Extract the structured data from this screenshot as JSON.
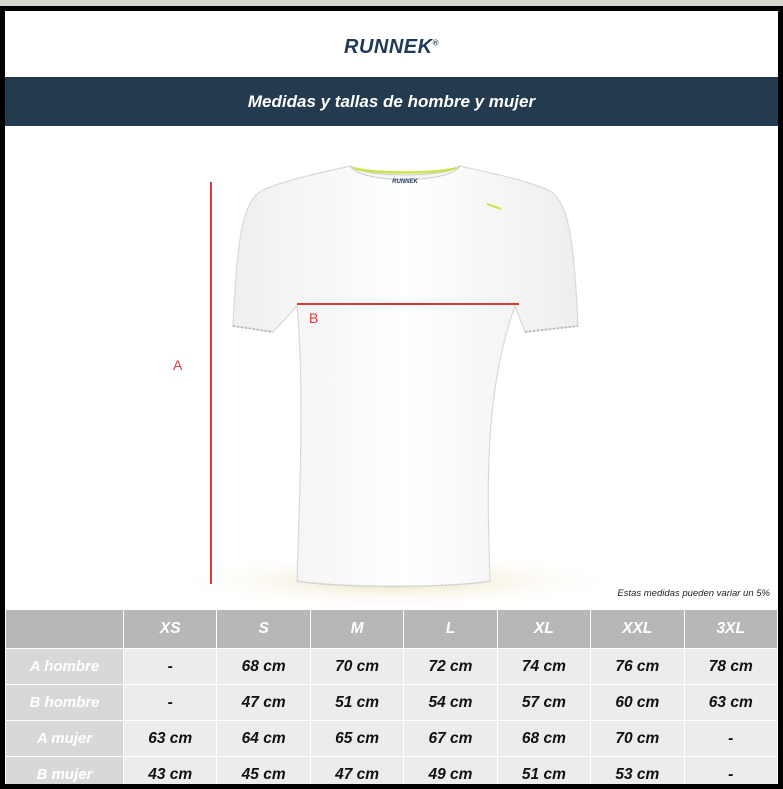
{
  "brand": {
    "name": "RUNNEK",
    "mark": "®"
  },
  "banner": {
    "title": "Medidas y tallas de hombre y mujer"
  },
  "illustration": {
    "label_a": "A",
    "label_b": "B",
    "collar_brand": "RUNNEK",
    "accent_color": "#c8e64b",
    "measure_color": "#d63a3a"
  },
  "note": "Estas medidas pueden variar un 5%",
  "table": {
    "headers": [
      "",
      "XS",
      "S",
      "M",
      "L",
      "XL",
      "XXL",
      "3XL"
    ],
    "rows": [
      {
        "label": "A hombre",
        "values": [
          "-",
          "68 cm",
          "70 cm",
          "72 cm",
          "74 cm",
          "76 cm",
          "78 cm"
        ]
      },
      {
        "label": "B hombre",
        "values": [
          "-",
          "47 cm",
          "51 cm",
          "54 cm",
          "57 cm",
          "60 cm",
          "63 cm"
        ]
      },
      {
        "label": "A mujer",
        "values": [
          "63 cm",
          "64 cm",
          "65 cm",
          "67 cm",
          "68 cm",
          "70 cm",
          "-"
        ]
      },
      {
        "label": "B mujer",
        "values": [
          "43 cm",
          "45 cm",
          "47 cm",
          "49 cm",
          "51 cm",
          "53 cm",
          "-"
        ]
      }
    ]
  },
  "colors": {
    "banner_bg": "#243a4e",
    "logo": "#1d3a5a",
    "header_bg": "#b7b7b9",
    "cell_bg": "#ececed"
  }
}
